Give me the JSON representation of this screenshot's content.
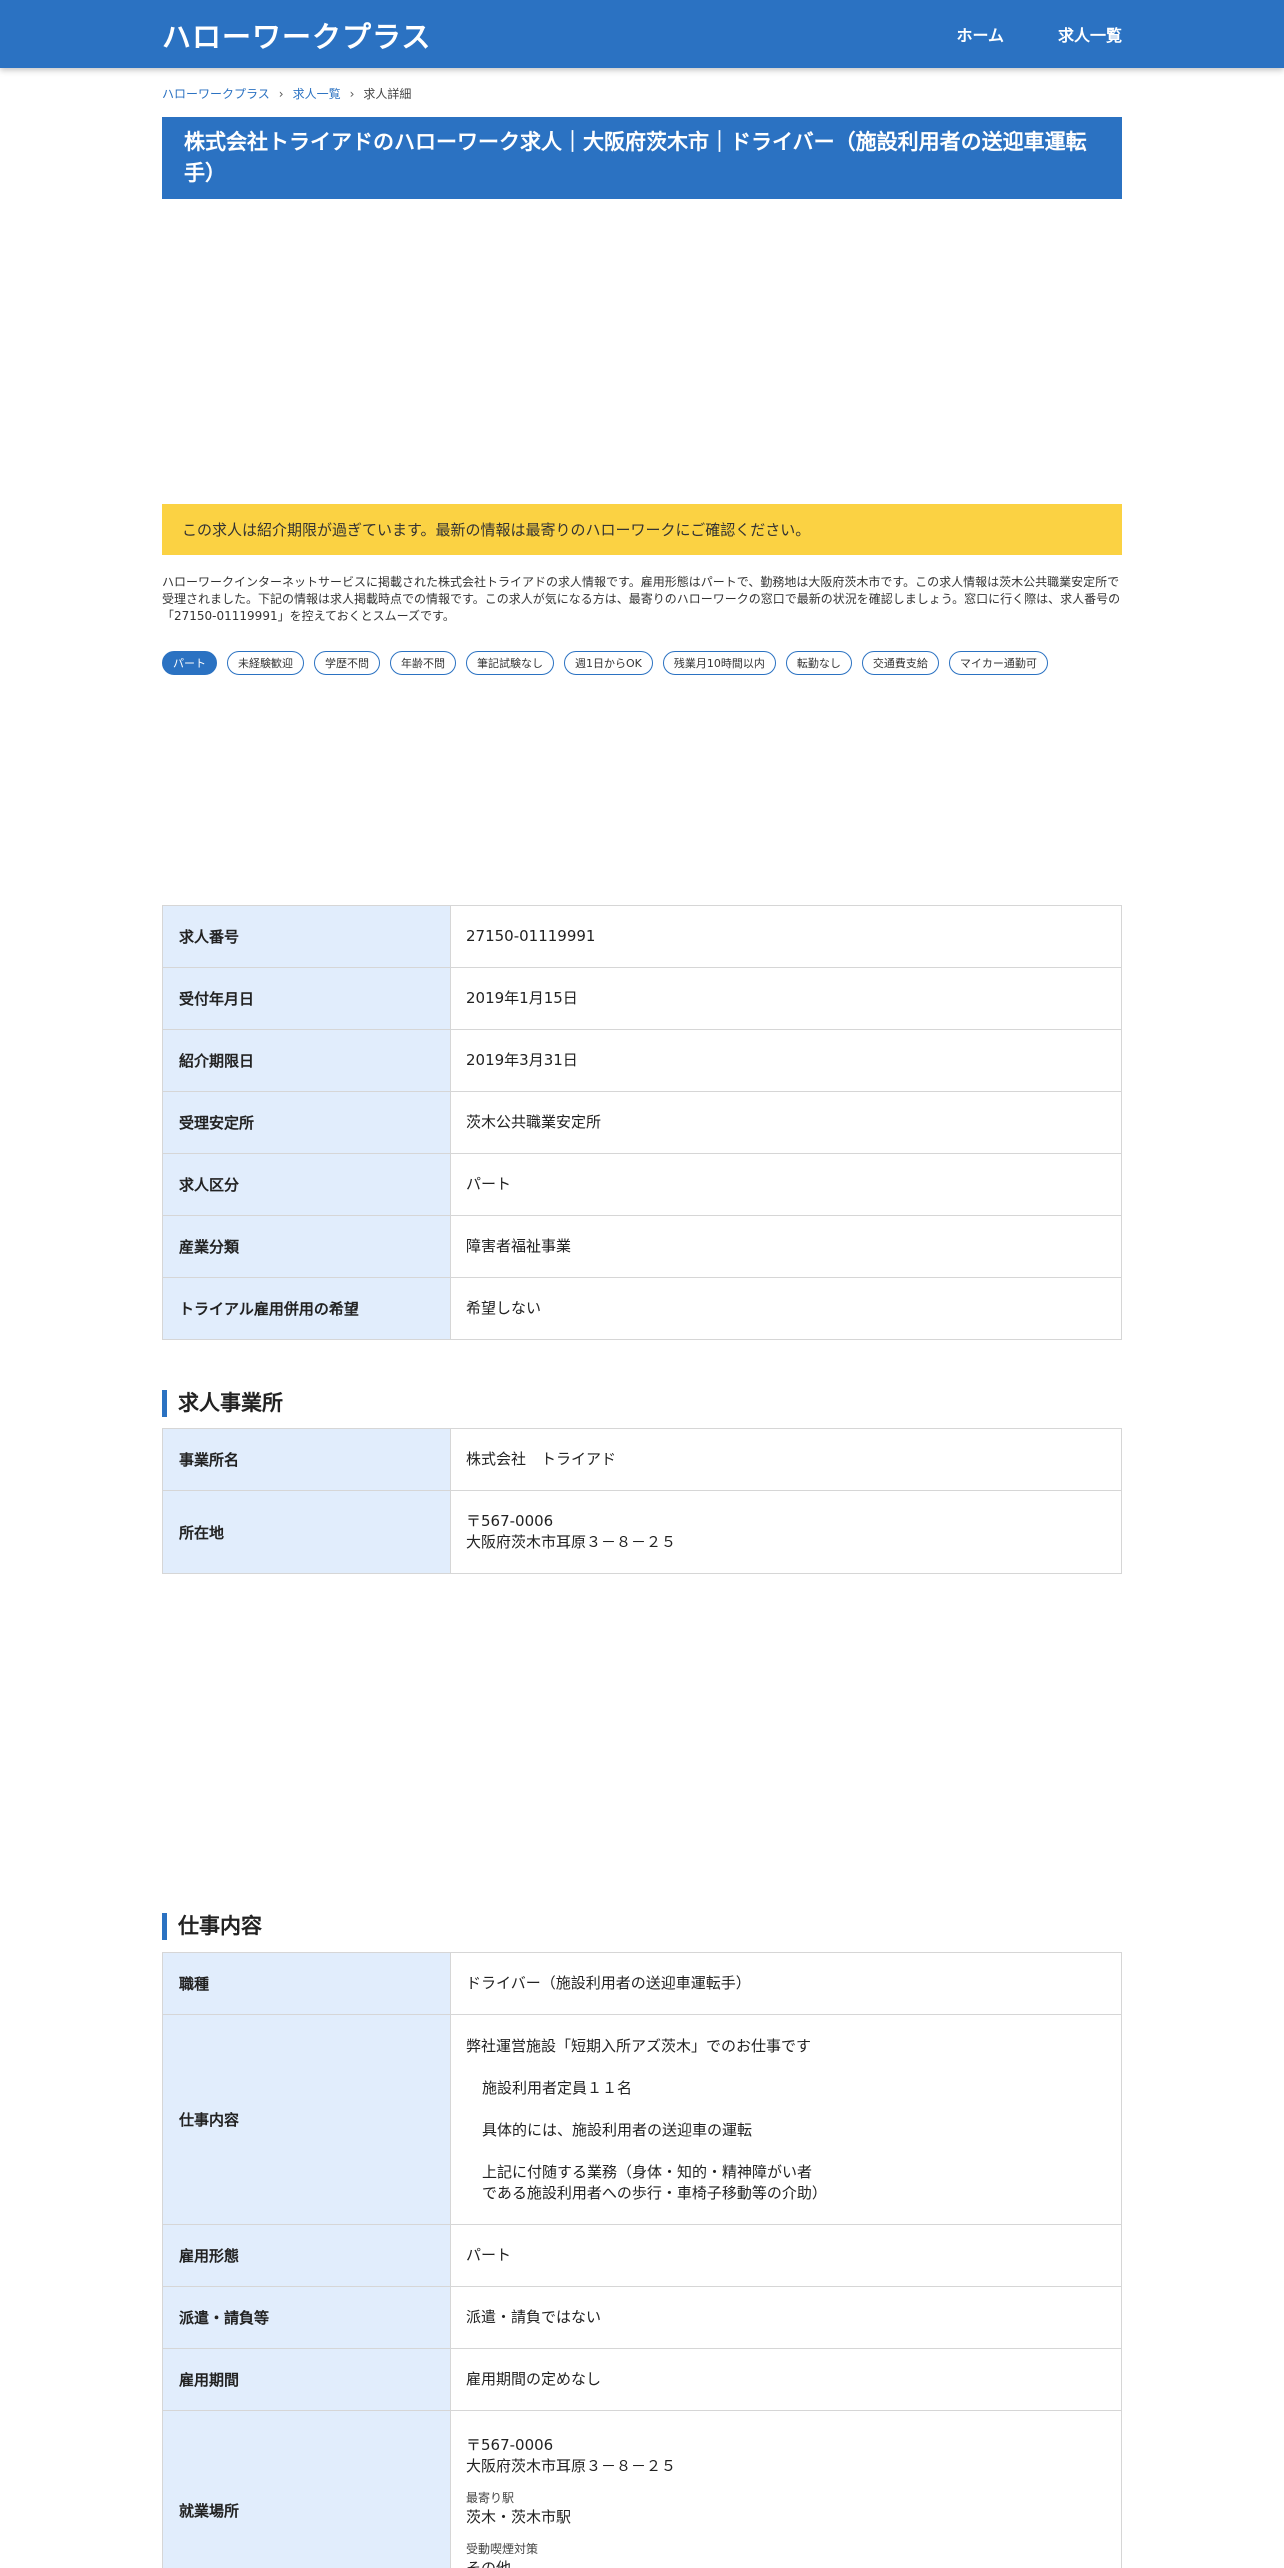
{
  "header": {
    "brand": "ハローワークプラス",
    "nav": [
      "ホーム",
      "求人一覧"
    ]
  },
  "breadcrumb": {
    "items": [
      "ハローワークプラス",
      "求人一覧"
    ],
    "current": "求人詳細"
  },
  "page_title": "株式会社トライアドのハローワーク求人｜大阪府茨木市｜ドライバー（施設利用者の送迎車運転手）",
  "notice": "この求人は紹介期限が過ぎています。最新の情報は最寄りのハローワークにご確認ください。",
  "description": "ハローワークインターネットサービスに掲載された株式会社トライアドの求人情報です。雇用形態はパートで、勤務地は大阪府茨木市です。この求人情報は茨木公共職業安定所で受理されました。下記の情報は求人掲載時点での情報です。この求人が気になる方は、最寄りのハローワークの窓口で最新の状況を確認しましょう。窓口に行く際は、求人番号の「27150-01119991」を控えておくとスムーズです。",
  "tags": [
    "パート",
    "未経験歓迎",
    "学歴不問",
    "年齢不問",
    "筆記試験なし",
    "週1日からOK",
    "残業月10時間以内",
    "転勤なし",
    "交通費支給",
    "マイカー通勤可"
  ],
  "basic_table": [
    {
      "label": "求人番号",
      "value": "27150-01119991"
    },
    {
      "label": "受付年月日",
      "value": "2019年1月15日"
    },
    {
      "label": "紹介期限日",
      "value": "2019年3月31日"
    },
    {
      "label": "受理安定所",
      "value": "茨木公共職業安定所"
    },
    {
      "label": "求人区分",
      "value": "パート"
    },
    {
      "label": "産業分類",
      "value": "障害者福祉事業"
    },
    {
      "label": "トライアル雇用併用の希望",
      "value": "希望しない"
    }
  ],
  "office_section": {
    "title": "求人事業所",
    "name_label": "事業所名",
    "name_value": "株式会社　トライアド",
    "address_label": "所在地",
    "postal": "〒567-0006",
    "address": "大阪府茨木市耳原３－８－２５"
  },
  "job_section": {
    "title": "仕事内容",
    "occupation_label": "職種",
    "occupation_value": "ドライバー（施設利用者の送迎車運転手）",
    "content_label": "仕事内容",
    "content_lines": [
      "弊社運営施設「短期入所アズ茨木」でのお仕事です",
      "施設利用者定員１１名",
      "具体的には、施設利用者の送迎車の運転",
      "上記に付随する業務（身体・知的・精神障がい者",
      "である施設利用者への歩行・車椅子移動等の介助）"
    ],
    "employment_label": "雇用形態",
    "employment_value": "パート",
    "dispatch_label": "派遣・請負等",
    "dispatch_value": "派遣・請負ではない",
    "period_label": "雇用期間",
    "period_value": "雇用期間の定めなし",
    "workplace_label": "就業場所",
    "workplace_postal": "〒567-0006",
    "workplace_address": "大阪府茨木市耳原３－８－２５",
    "station_label": "最寄り駅",
    "station_value": "茨木・茨木市駅",
    "smoking_label": "受動喫煙対策",
    "smoking_value": "その他"
  }
}
